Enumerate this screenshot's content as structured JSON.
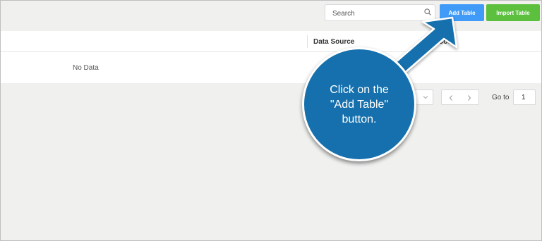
{
  "toolbar": {
    "search_placeholder": "Search",
    "add_table_label": "Add Table",
    "import_table_label": "Import Table"
  },
  "table": {
    "columns": [
      "Data Source",
      "Code"
    ],
    "empty_text": "No Data"
  },
  "pagination": {
    "prev_glyph": "<",
    "next_glyph": ">",
    "goto_label": "Go to",
    "goto_value": "1"
  },
  "callout": {
    "lines": [
      "Click on the",
      "\"Add Table\"",
      "button."
    ]
  },
  "colors": {
    "add_button": "#3f9bf7",
    "import_button": "#5cbf3e",
    "callout": "#1670ad"
  }
}
